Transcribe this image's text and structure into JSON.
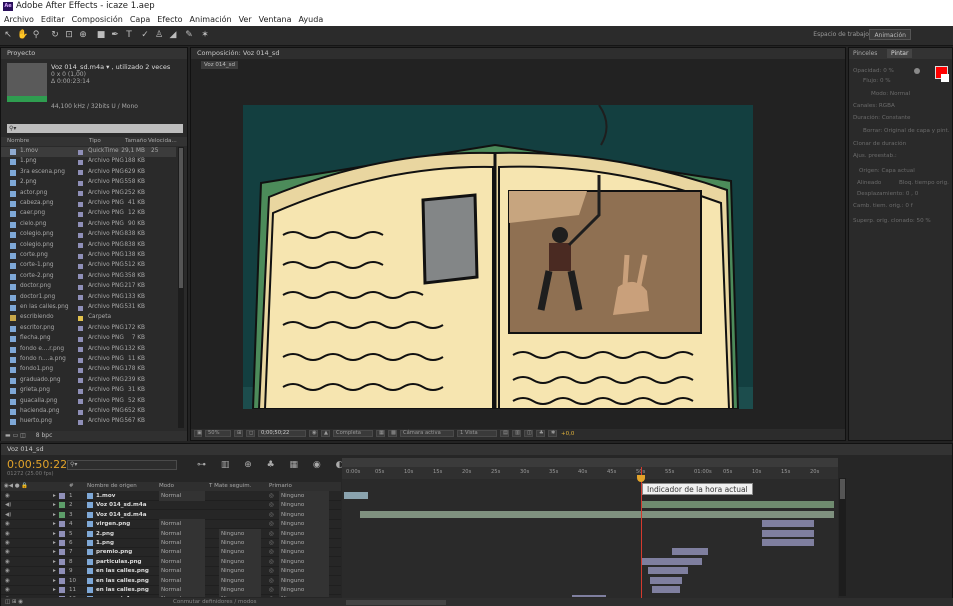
{
  "window": {
    "title": "Adobe After Effects - icaze 1.aep",
    "icon_text": "Ae"
  },
  "menu": [
    "Archivo",
    "Editar",
    "Composición",
    "Capa",
    "Efecto",
    "Animación",
    "Ver",
    "Ventana",
    "Ayuda"
  ],
  "toolbar": {
    "workspace_label": "Espacio de trabajo:",
    "workspace_value": "Animación"
  },
  "project": {
    "tab": "Proyecto",
    "selected_name": "Voz 014_sd.m4a ▾ , utilizado 2 veces",
    "delta": "0 x 0 (1,00)",
    "duration": "Δ 0:00:23:14",
    "audio": "44,100 kHz / 32bits U / Mono",
    "columns": {
      "name": "Nombre",
      "type": "Tipo",
      "size": "Tamaño",
      "rate": "Velocida..."
    },
    "items": [
      {
        "name": "1.mov",
        "type": "QuickTime",
        "size": "29,1 MB",
        "rate": "25"
      },
      {
        "name": "1.png",
        "type": "Archivo PNG",
        "size": "188 KB",
        "rate": ""
      },
      {
        "name": "3ra escena.png",
        "type": "Archivo PNG",
        "size": "629 KB",
        "rate": ""
      },
      {
        "name": "2.png",
        "type": "Archivo PNG",
        "size": "558 KB",
        "rate": ""
      },
      {
        "name": "actor.png",
        "type": "Archivo PNG",
        "size": "252 KB",
        "rate": ""
      },
      {
        "name": "cabeza.png",
        "type": "Archivo PNG",
        "size": "41 KB",
        "rate": ""
      },
      {
        "name": "caer.png",
        "type": "Archivo PNG",
        "size": "12 KB",
        "rate": ""
      },
      {
        "name": "cielo.png",
        "type": "Archivo PNG",
        "size": "90 KB",
        "rate": ""
      },
      {
        "name": "colegio.png",
        "type": "Archivo PNG",
        "size": "838 KB",
        "rate": ""
      },
      {
        "name": "colegio.png",
        "type": "Archivo PNG",
        "size": "838 KB",
        "rate": ""
      },
      {
        "name": "corte.png",
        "type": "Archivo PNG",
        "size": "138 KB",
        "rate": ""
      },
      {
        "name": "corte-1.png",
        "type": "Archivo PNG",
        "size": "512 KB",
        "rate": ""
      },
      {
        "name": "corte-2.png",
        "type": "Archivo PNG",
        "size": "358 KB",
        "rate": ""
      },
      {
        "name": "doctor.png",
        "type": "Archivo PNG",
        "size": "217 KB",
        "rate": ""
      },
      {
        "name": "doctor1.png",
        "type": "Archivo PNG",
        "size": "133 KB",
        "rate": ""
      },
      {
        "name": "en las calles.png",
        "type": "Archivo PNG",
        "size": "531 KB",
        "rate": ""
      },
      {
        "name": "escribiendo",
        "type": "Carpeta",
        "size": "",
        "rate": ""
      },
      {
        "name": "escritor.png",
        "type": "Archivo PNG",
        "size": "172 KB",
        "rate": ""
      },
      {
        "name": "flecha.png",
        "type": "Archivo PNG",
        "size": "7 KB",
        "rate": ""
      },
      {
        "name": "fondo e....r.png",
        "type": "Archivo PNG",
        "size": "132 KB",
        "rate": ""
      },
      {
        "name": "fondo n....a.png",
        "type": "Archivo PNG",
        "size": "11 KB",
        "rate": ""
      },
      {
        "name": "fondo1.png",
        "type": "Archivo PNG",
        "size": "178 KB",
        "rate": ""
      },
      {
        "name": "graduado.png",
        "type": "Archivo PNG",
        "size": "239 KB",
        "rate": ""
      },
      {
        "name": "grieta.png",
        "type": "Archivo PNG",
        "size": "31 KB",
        "rate": ""
      },
      {
        "name": "guacalla.png",
        "type": "Archivo PNG",
        "size": "52 KB",
        "rate": ""
      },
      {
        "name": "hacienda.png",
        "type": "Archivo PNG",
        "size": "652 KB",
        "rate": ""
      },
      {
        "name": "huerto.png",
        "type": "Archivo PNG",
        "size": "567 KB",
        "rate": ""
      }
    ],
    "bpc": "8 bpc"
  },
  "composition": {
    "tab": "Composición: Voz 014_sd",
    "subtab": "Voz 014_sd",
    "zoom": "50%",
    "timecode": "0;00;50;22",
    "resolution": "Completa",
    "camera": "Cámara activa",
    "views": "1 Vista",
    "exposure": "+0,0"
  },
  "paint": {
    "tabs": [
      "Pinceles",
      "Pintar"
    ],
    "fields": [
      "Opacidad: 0 %",
      "Flujo: 0 %",
      "Modo: Normal",
      "Canales: RGBA",
      "Duración: Constante",
      "Borrar: Original de capa y pint.",
      "Clonar de duración",
      "Ajus. preestab.:",
      "Origen: Capa actual",
      "Alineado",
      "Bloq. tiempo orig.",
      "Desplazamiento: 0 , 0",
      "Camb. tiem. orig.: 0 f",
      "Superp. orig. clonado: 50 %"
    ],
    "fg_color": "#ff0000"
  },
  "timeline": {
    "tab": "Voz 014_sd",
    "timecode": "0:00:50:22",
    "fps_line": "01272 (25.00 fps)",
    "columns": {
      "num": "#",
      "name": "Nombre de origen",
      "mode": "Modo",
      "trkmat": "T Mate seguim.",
      "parent": "Primario"
    },
    "tooltip": "Indicador de la hora actual",
    "ruler": [
      "0:00s",
      "05s",
      "10s",
      "15s",
      "20s",
      "25s",
      "30s",
      "35s",
      "40s",
      "45s",
      "50s",
      "55s",
      "01:00s",
      "05s",
      "10s",
      "15s",
      "20s"
    ],
    "footer": "Conmutar definidores / modos",
    "layers": [
      {
        "n": "1",
        "name": "1.mov",
        "mode": "Normal",
        "trk": "",
        "parent": "Ninguno"
      },
      {
        "n": "2",
        "name": "Voz 014_sd.m4a",
        "mode": "",
        "trk": "",
        "parent": "Ninguno"
      },
      {
        "n": "3",
        "name": "Voz 014_sd.m4a",
        "mode": "",
        "trk": "",
        "parent": "Ninguno"
      },
      {
        "n": "4",
        "name": "virgen.png",
        "mode": "Normal",
        "trk": "",
        "parent": "Ninguno"
      },
      {
        "n": "5",
        "name": "2.png",
        "mode": "Normal",
        "trk": "Ninguno",
        "parent": "Ninguno"
      },
      {
        "n": "6",
        "name": "1.png",
        "mode": "Normal",
        "trk": "Ninguno",
        "parent": "Ninguno"
      },
      {
        "n": "7",
        "name": "premio.png",
        "mode": "Normal",
        "trk": "Ninguno",
        "parent": "Ninguno"
      },
      {
        "n": "8",
        "name": "particulas.png",
        "mode": "Normal",
        "trk": "Ninguno",
        "parent": "Ninguno"
      },
      {
        "n": "9",
        "name": "en las calles.png",
        "mode": "Normal",
        "trk": "Ninguno",
        "parent": "Ninguno"
      },
      {
        "n": "10",
        "name": "en las calles.png",
        "mode": "Normal",
        "trk": "Ninguno",
        "parent": "Ninguno"
      },
      {
        "n": "11",
        "name": "en las calles.png",
        "mode": "Normal",
        "trk": "Ninguno",
        "parent": "Ninguno"
      },
      {
        "n": "12",
        "name": "escenario1.png",
        "mode": "Normal",
        "trk": "Ninguno",
        "parent": "Ninguno"
      }
    ]
  }
}
